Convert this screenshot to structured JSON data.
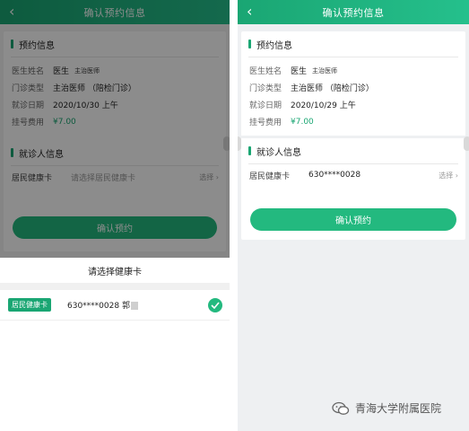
{
  "left": {
    "header": {
      "back_icon": "chevron-left-icon",
      "title": "确认预约信息"
    },
    "appointment": {
      "section_title": "预约信息",
      "doctor_label": "医生姓名",
      "doctor_name": "医生",
      "doctor_title": "主治医师",
      "clinic_label": "门诊类型",
      "clinic_value": "主治医师 （陪检门诊）",
      "date_label": "就诊日期",
      "date_value": "2020/10/30 上午",
      "fee_label": "挂号费用",
      "fee_value": "¥7.00"
    },
    "patient": {
      "section_title": "就诊人信息",
      "card_label": "居民健康卡",
      "card_placeholder": "请选择居民健康卡",
      "select_label": "选择"
    },
    "confirm_button": "确认预约",
    "sheet": {
      "title": "请选择健康卡",
      "badge": "居民健康卡",
      "card_number": "630****0028 郭"
    }
  },
  "right": {
    "header": {
      "back_icon": "chevron-left-icon",
      "title": "确认预约信息"
    },
    "appointment": {
      "section_title": "预约信息",
      "doctor_label": "医生姓名",
      "doctor_name": "医生",
      "doctor_title": "主治医师",
      "clinic_label": "门诊类型",
      "clinic_value": "主治医师 （陪检门诊）",
      "date_label": "就诊日期",
      "date_value": "2020/10/29 上午",
      "fee_label": "挂号费用",
      "fee_value": "¥7.00"
    },
    "patient": {
      "section_title": "就诊人信息",
      "card_label": "居民健康卡",
      "card_value": "630****0028",
      "select_label": "选择"
    },
    "confirm_button": "确认预约"
  },
  "watermark": {
    "text": "青海大学附属医院",
    "icon": "wechat-icon"
  },
  "colors": {
    "accent": "#1aa673",
    "button": "#23b97f"
  }
}
